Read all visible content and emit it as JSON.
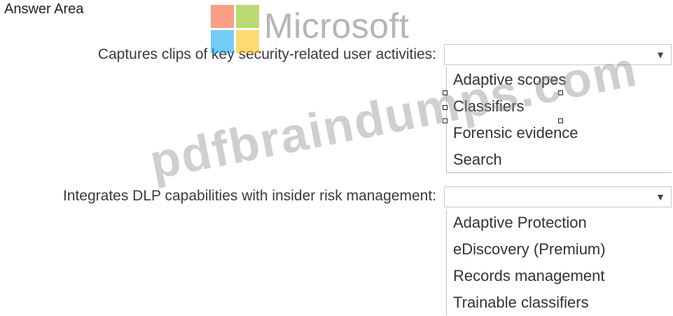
{
  "title": "Answer Area",
  "questions": [
    {
      "prompt": "Captures clips of key security-related user activities:",
      "selected": "",
      "options": [
        "Adaptive scopes",
        "Classifiers",
        "Forensic evidence",
        "Search"
      ]
    },
    {
      "prompt": "Integrates DLP capabilities with insider risk management:",
      "selected": "",
      "options": [
        "Adaptive Protection",
        "eDiscovery (Premium)",
        "Records management",
        "Trainable classifiers"
      ]
    }
  ],
  "icons": {
    "dropdown_arrow": "chevron-down-icon"
  },
  "colors": {
    "logo_red": "#f25022",
    "logo_green": "#7fba00",
    "logo_blue": "#00a4ef",
    "logo_yellow": "#ffb900"
  },
  "watermarks": {
    "logo_text": "Microsoft",
    "site": "pdfbraindumps.com"
  }
}
